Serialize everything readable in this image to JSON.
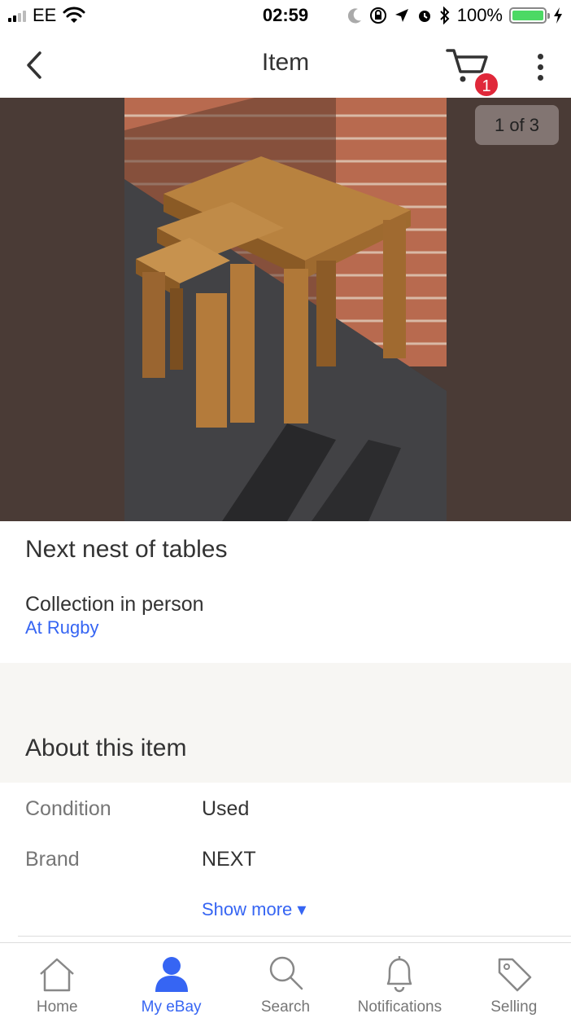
{
  "status_bar": {
    "carrier": "EE",
    "time": "02:59",
    "battery": "100%"
  },
  "nav": {
    "title": "Item",
    "cart_count": "1",
    "icons": [
      "back-chevron-icon",
      "cart-icon",
      "more-vertical-icon"
    ]
  },
  "gallery": {
    "counter": "1 of 3"
  },
  "item": {
    "title": "Next nest of tables",
    "delivery": "Collection in person",
    "location": "At Rugby"
  },
  "about": {
    "heading": "About this item",
    "specs": [
      {
        "label": "Condition",
        "value": "Used"
      },
      {
        "label": "Brand",
        "value": "NEXT"
      }
    ],
    "show_more": "Show more ▾"
  },
  "tabs": [
    {
      "label": "Home",
      "icon": "home-icon",
      "active": false
    },
    {
      "label": "My eBay",
      "icon": "person-icon",
      "active": true
    },
    {
      "label": "Search",
      "icon": "search-icon",
      "active": false
    },
    {
      "label": "Notifications",
      "icon": "bell-icon",
      "active": false
    },
    {
      "label": "Selling",
      "icon": "tag-icon",
      "active": false
    }
  ],
  "colors": {
    "accent": "#3665f3",
    "badge": "#e0283a",
    "gallery_bg": "#4a3b36",
    "section_bg": "#f7f6f3"
  }
}
